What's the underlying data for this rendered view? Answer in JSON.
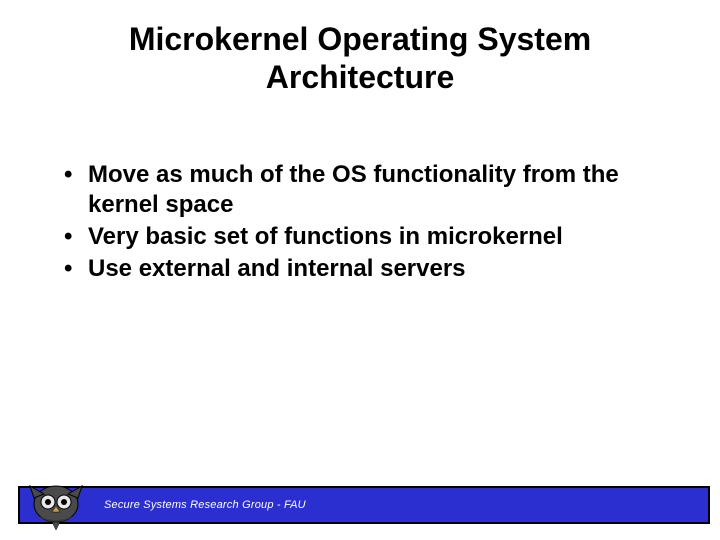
{
  "title": "Microkernel Operating System Architecture",
  "bullets": [
    "Move as much of the OS functionality from the kernel space",
    "Very basic set of functions in microkernel",
    "Use external and internal servers"
  ],
  "footer": {
    "text": "Secure Systems Research Group - FAU",
    "logo_name": "owl-logo"
  }
}
